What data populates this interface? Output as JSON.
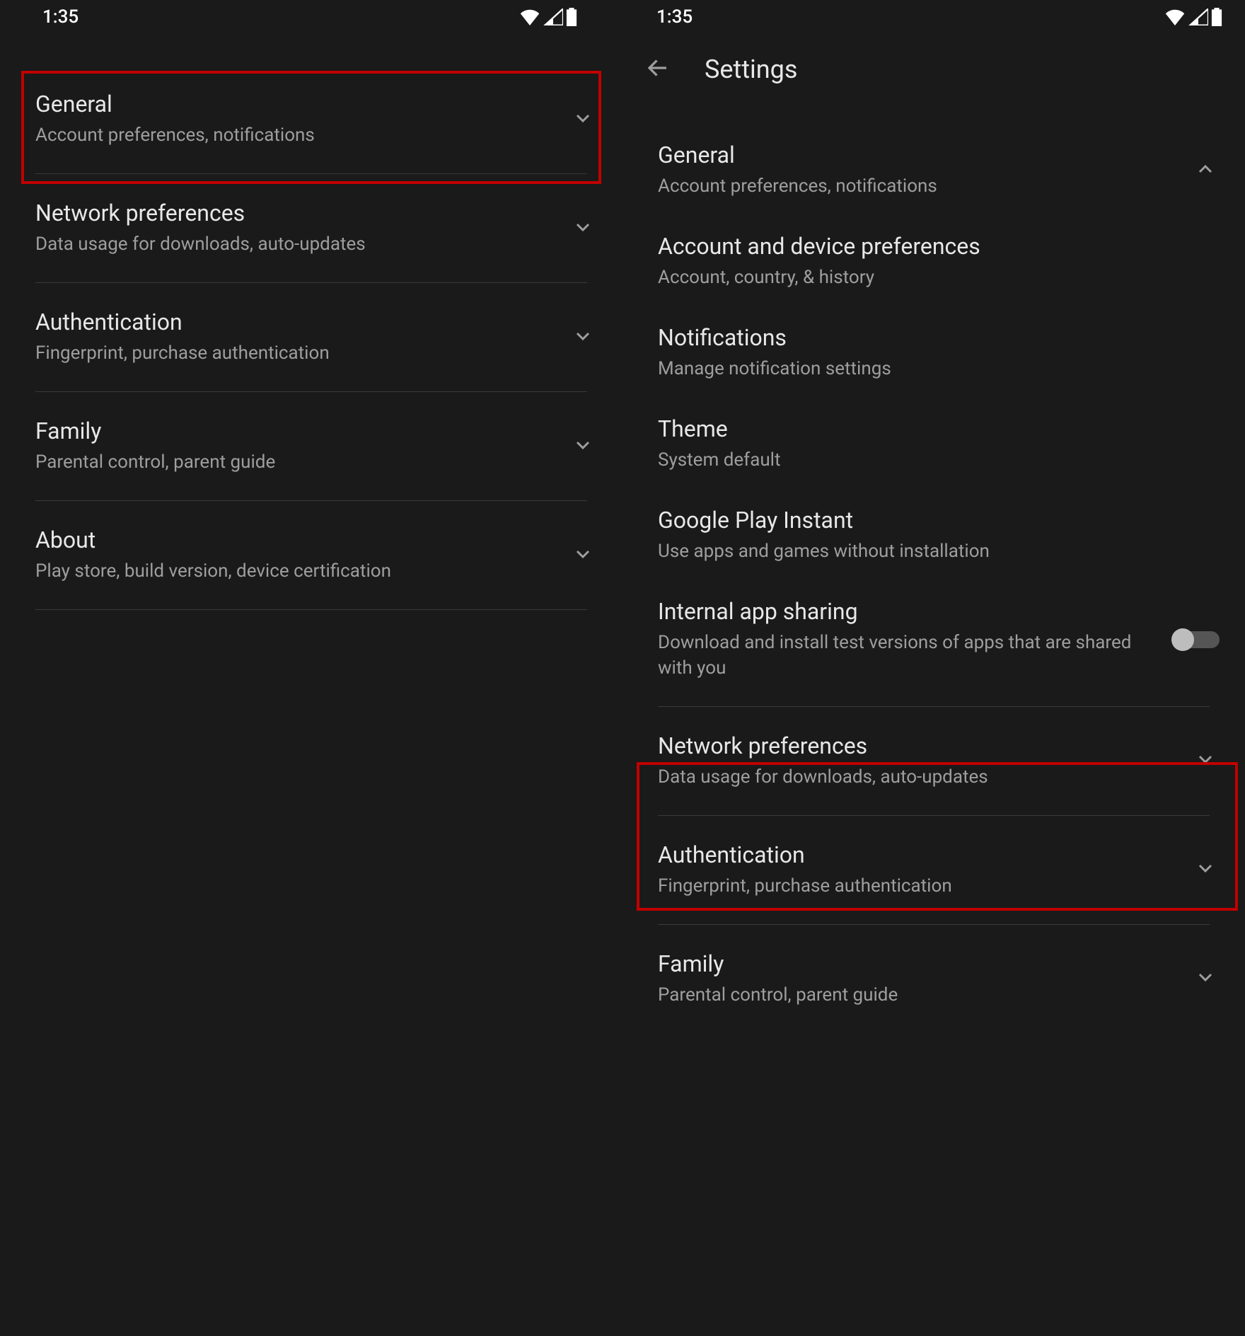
{
  "status": {
    "time": "1:35"
  },
  "header": {
    "title": "Settings"
  },
  "left": {
    "items": [
      {
        "title": "General",
        "sub": "Account preferences, notifications"
      },
      {
        "title": "Network preferences",
        "sub": "Data usage for downloads, auto-updates"
      },
      {
        "title": "Authentication",
        "sub": "Fingerprint, purchase authentication"
      },
      {
        "title": "Family",
        "sub": "Parental control, parent guide"
      },
      {
        "title": "About",
        "sub": "Play store, build version, device certification"
      }
    ]
  },
  "right": {
    "items": [
      {
        "title": "General",
        "sub": "Account preferences, notifications"
      },
      {
        "title": "Account and device preferences",
        "sub": "Account, country, & history"
      },
      {
        "title": "Notifications",
        "sub": "Manage notification settings"
      },
      {
        "title": "Theme",
        "sub": "System default"
      },
      {
        "title": "Google Play Instant",
        "sub": "Use apps and games without installation"
      },
      {
        "title": "Internal app sharing",
        "sub": "Download and install test versions of apps that are shared with you"
      },
      {
        "title": "Network preferences",
        "sub": "Data usage for downloads, auto-updates"
      },
      {
        "title": "Authentication",
        "sub": "Fingerprint, purchase authentication"
      },
      {
        "title": "Family",
        "sub": "Parental control, parent guide"
      }
    ]
  }
}
